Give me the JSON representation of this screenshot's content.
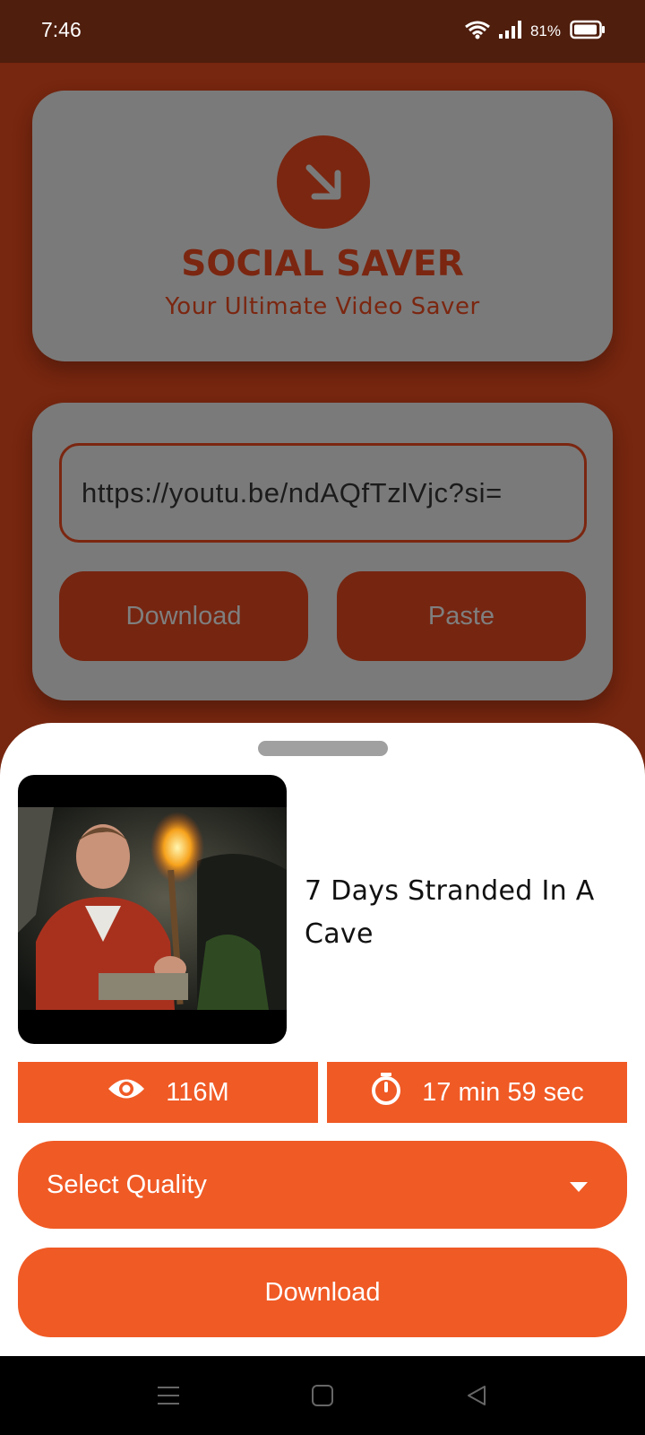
{
  "status_bar": {
    "time": "7:46",
    "battery": "81%",
    "icons": [
      "wifi-icon",
      "signal-icon",
      "battery-icon"
    ]
  },
  "header": {
    "title": "SOCIAL SAVER",
    "subtitle": "Your Ultimate Video Saver",
    "logo_icon": "download-arrow-icon"
  },
  "url_form": {
    "value": "https://youtu.be/ndAQfTzlVjc?si=",
    "download_label": "Download",
    "paste_label": "Paste"
  },
  "sheet": {
    "video_title": "7 Days Stranded In A Cave",
    "views": "116M",
    "duration": "17 min 59 sec",
    "quality_label": "Select Quality",
    "download_label": "Download"
  },
  "colors": {
    "accent": "#f05a25",
    "brand_dark": "#7b2610",
    "overlay_card": "#7a7a7a"
  }
}
